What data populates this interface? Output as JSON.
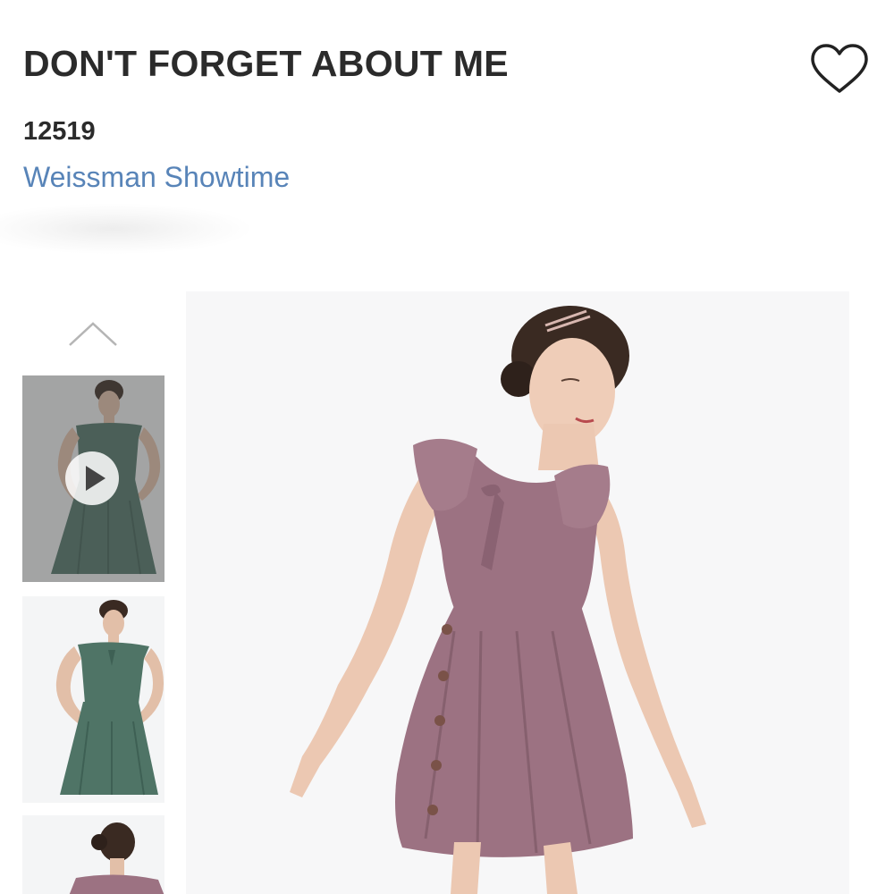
{
  "product": {
    "title": "DON'T FORGET ABOUT ME",
    "sku": "12519",
    "brand": "Weissman Showtime"
  },
  "colors": {
    "title": "#2b2b2b",
    "brand_link": "#5884b8",
    "dress_main": "#9c7282",
    "dress_alt": "#4f7466"
  },
  "icons": {
    "favorite": "heart-outline-icon",
    "gallery_up": "chevron-up-icon",
    "video": "play-icon"
  }
}
